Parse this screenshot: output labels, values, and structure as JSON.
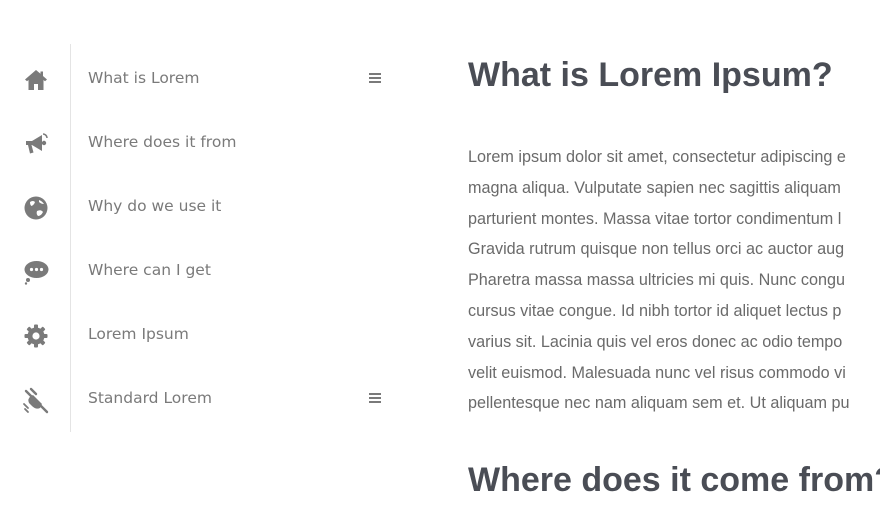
{
  "sidebar": {
    "items": [
      {
        "label": "What is Lorem",
        "icon": "home-icon",
        "has_menu": true
      },
      {
        "label": "Where does it from",
        "icon": "megaphone-icon",
        "has_menu": false
      },
      {
        "label": "Why do we use it",
        "icon": "globe-icon",
        "has_menu": false
      },
      {
        "label": "Where can I get",
        "icon": "chat-bubble-icon",
        "has_menu": false
      },
      {
        "label": "Lorem Ipsum",
        "icon": "gear-icon",
        "has_menu": false
      },
      {
        "label": "Standard Lorem",
        "icon": "plug-icon",
        "has_menu": true
      }
    ]
  },
  "main": {
    "heading_1": "What is Lorem Ipsum?",
    "paragraph_lines": [
      "Lorem ipsum dolor sit amet, consectetur adipiscing e",
      "magna aliqua. Vulputate sapien nec sagittis aliquam",
      "parturient montes. Massa vitae tortor condimentum l",
      "Gravida rutrum quisque non tellus orci ac auctor aug",
      "Pharetra massa massa ultricies mi quis. Nunc congu",
      "cursus vitae congue. Id nibh tortor id aliquet lectus p",
      "varius sit. Lacinia quis vel eros donec ac odio tempo",
      "velit euismod. Malesuada nunc vel risus commodo vi",
      "pellentesque nec nam aliquam sem et. Ut aliquam pu"
    ],
    "heading_2": "Where does it come from?"
  },
  "colors": {
    "icon": "#7a7a7a",
    "label": "#7a7a7a",
    "heading": "#4a4d55",
    "body_text": "#6a6a6a",
    "divider": "#e4e4e4"
  }
}
